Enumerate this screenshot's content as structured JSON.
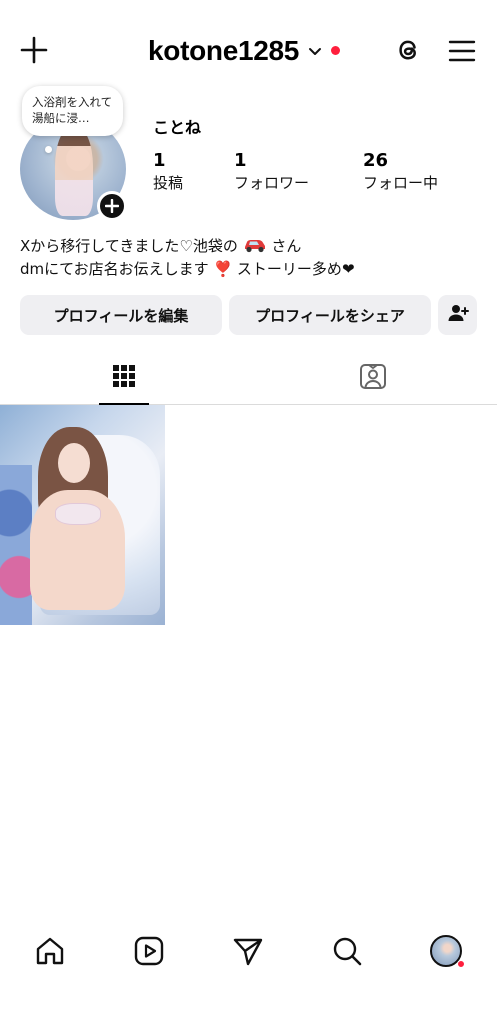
{
  "header": {
    "username": "kotone1285",
    "notification_dot_color": "#ff1f3d",
    "icons": [
      "add-icon",
      "chevron-down-icon",
      "threads-icon",
      "hamburger-menu-icon"
    ]
  },
  "profile": {
    "note": "入浴剤を入れて湯船に浸…",
    "display_name": "ことね",
    "stats": [
      {
        "value": "1",
        "label": "投稿"
      },
      {
        "value": "1",
        "label": "フォロワー"
      },
      {
        "value": "26",
        "label": "フォロー中"
      }
    ],
    "bio_line1_before": "Xから移行してきました♡池袋の",
    "bio_line1_after": "さん",
    "bio_line2_before": "dmにてお店名お伝えします",
    "bio_line2_heart": "❣️",
    "bio_line2_after": " ストーリー多め",
    "bio_line2_end": "❤"
  },
  "buttons": {
    "edit": "プロフィールを編集",
    "share": "プロフィールをシェア"
  },
  "tabs": [
    {
      "name": "posts-grid",
      "icon": "grid-icon",
      "active": true
    },
    {
      "name": "tagged",
      "icon": "tagged-person-icon",
      "active": false
    }
  ],
  "posts": [
    {
      "kind": "photo"
    }
  ],
  "bottom_nav": {
    "items": [
      "home-icon",
      "reels-icon",
      "send-icon",
      "search-icon",
      "profile-avatar"
    ],
    "dot_color": "#ff1f3d"
  }
}
